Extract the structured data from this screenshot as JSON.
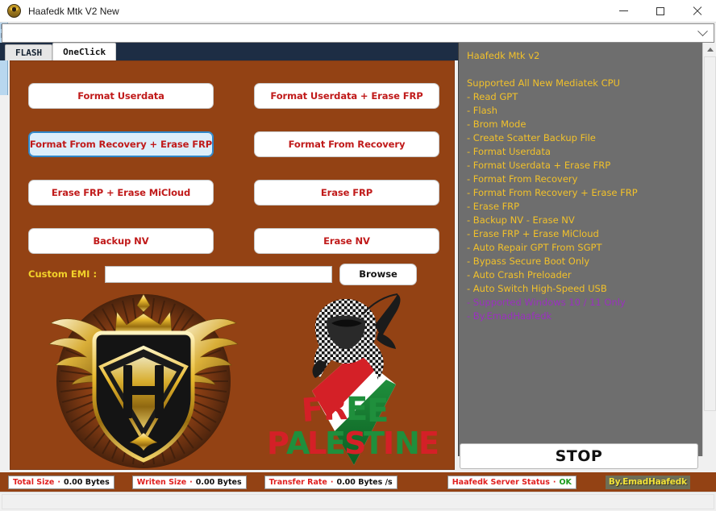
{
  "window": {
    "title": "Haafedk Mtk V2 New",
    "icon": "app-emblem-icon",
    "minimize": "—",
    "maximize": "□",
    "close": "×"
  },
  "topcombo": {
    "value": "",
    "icon": "chevron-down-icon"
  },
  "tabs": [
    {
      "label": "FLASH",
      "active": false
    },
    {
      "label": "OneClick",
      "active": true
    }
  ],
  "actions": [
    {
      "label": "Format Userdata",
      "focused": false
    },
    {
      "label": "Format Userdata + Erase FRP",
      "focused": false
    },
    {
      "label": "Format From Recovery + Erase FRP",
      "focused": true
    },
    {
      "label": "Format From Recovery",
      "focused": false
    },
    {
      "label": "Erase FRP + Erase MiCloud",
      "focused": false
    },
    {
      "label": "Erase FRP",
      "focused": false
    },
    {
      "label": "Backup NV",
      "focused": false
    },
    {
      "label": "Erase NV",
      "focused": false
    }
  ],
  "emi": {
    "label": "Custom EMI :",
    "value": "",
    "placeholder": "",
    "browse_label": "Browse"
  },
  "artwork": {
    "emblem_name": "haafedk-gold-shield-emblem",
    "flag_name": "free-palestine-graphic",
    "flag_line1": "FREE",
    "flag_line2": "PALESTINE"
  },
  "log": {
    "lines": [
      {
        "text": "Haafedk Mtk v2",
        "color": "yellow"
      },
      {
        "text": "",
        "color": "blank"
      },
      {
        "text": "Supported All New Mediatek CPU",
        "color": "yellow"
      },
      {
        "text": "- Read GPT",
        "color": "yellow"
      },
      {
        "text": "- Flash",
        "color": "yellow"
      },
      {
        "text": "- Brom Mode",
        "color": "yellow"
      },
      {
        "text": "- Create Scatter Backup File",
        "color": "yellow"
      },
      {
        "text": "- Format Userdata",
        "color": "yellow"
      },
      {
        "text": "- Format Userdata + Erase FRP",
        "color": "yellow"
      },
      {
        "text": "- Format From Recovery",
        "color": "yellow"
      },
      {
        "text": "- Format From Recovery + Erase FRP",
        "color": "yellow"
      },
      {
        "text": "- Erase FRP",
        "color": "yellow"
      },
      {
        "text": "- Backup NV - Erase NV",
        "color": "yellow"
      },
      {
        "text": "- Erase FRP + Erase MiCloud",
        "color": "yellow"
      },
      {
        "text": "- Auto Repair GPT From SGPT",
        "color": "yellow"
      },
      {
        "text": "- Bypass Secure Boot Only",
        "color": "yellow"
      },
      {
        "text": "- Auto Crash Preloader",
        "color": "yellow"
      },
      {
        "text": "- Auto Switch High-Speed USB",
        "color": "yellow"
      },
      {
        "text": "- Supported Windows 10 / 11 Only",
        "color": "purple"
      },
      {
        "text": "- By.EmadHaafedk",
        "color": "purple"
      }
    ],
    "scroll_up_icon": "scroll-up-arrow-icon"
  },
  "stop": {
    "label": "STOP"
  },
  "status": {
    "total_size": {
      "key": "Total Size",
      "sep": "·",
      "value": "0.00 Bytes"
    },
    "written_size": {
      "key": "Writen Size",
      "sep": "·",
      "value": "0.00 Bytes"
    },
    "transfer_rate": {
      "key": "Transfer Rate",
      "sep": "·",
      "value": "0.00 Bytes /s"
    },
    "server_status": {
      "key": "Haafedk Server Status",
      "sep": "·",
      "value": "OK"
    },
    "credit": "By.EmadHaafedk"
  },
  "colors": {
    "panel_brown": "#934214",
    "log_bg": "#6e6e6e",
    "log_yellow": "#f2c12a",
    "log_purple": "#9b30c0",
    "button_red": "#c01a1a",
    "emi_yellow": "#f2d22a",
    "tabband_navy": "#1d2d44",
    "focus_blue": "#2e86c8",
    "status_ok_green": "#1a9a1a"
  }
}
